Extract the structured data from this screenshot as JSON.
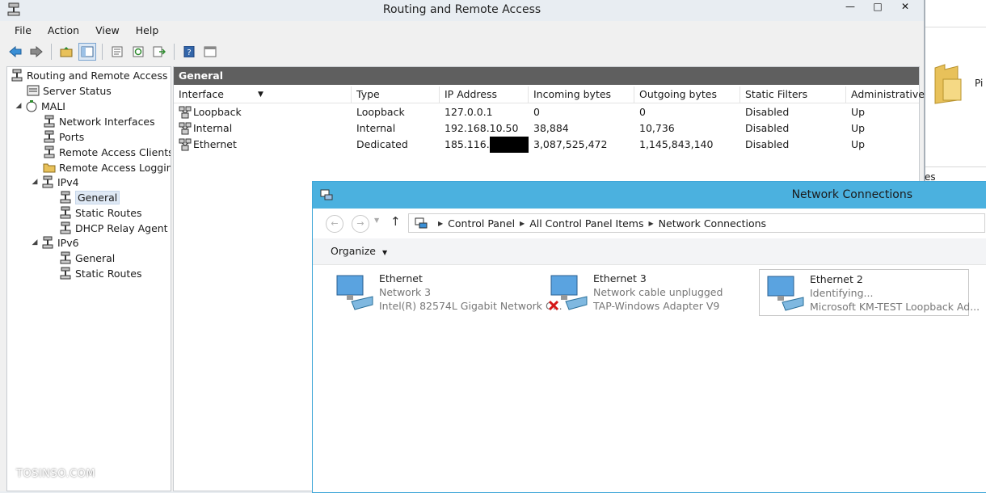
{
  "rras": {
    "title": "Routing and Remote Access",
    "menu": [
      "File",
      "Action",
      "View",
      "Help"
    ],
    "tree": {
      "root": "Routing and Remote Access",
      "server_status": "Server Status",
      "server": "MALI",
      "items": [
        "Network Interfaces",
        "Ports",
        "Remote Access Clients (",
        "Remote Access Logging"
      ],
      "ipv4": "IPv4",
      "ipv4_items": [
        "General",
        "Static Routes",
        "DHCP Relay Agent"
      ],
      "ipv6": "IPv6",
      "ipv6_items": [
        "General",
        "Static Routes"
      ]
    },
    "panel_title": "General",
    "columns": [
      "Interface",
      "Type",
      "IP Address",
      "Incoming bytes",
      "Outgoing bytes",
      "Static Filters",
      "Administrative"
    ],
    "rows": [
      {
        "interface": "Loopback",
        "type": "Loopback",
        "ip": "127.0.0.1",
        "in": "0",
        "out": "0",
        "filters": "Disabled",
        "admin": "Up"
      },
      {
        "interface": "Internal",
        "type": "Internal",
        "ip": "192.168.10.50",
        "in": "38,884",
        "out": "10,736",
        "filters": "Disabled",
        "admin": "Up"
      },
      {
        "interface": "Ethernet",
        "type": "Dedicated",
        "ip": "185.116.",
        "in": "3,087,525,472",
        "out": "1,145,843,140",
        "filters": "Disabled",
        "admin": "Up"
      }
    ]
  },
  "netconn": {
    "title": "Network Connections",
    "breadcrumb": [
      "Control Panel",
      "All Control Panel Items",
      "Network Connections"
    ],
    "organize": "Organize",
    "adapters": [
      {
        "name": "Ethernet",
        "status": "Network  3",
        "device": "Intel(R) 82574L Gigabit Network C..."
      },
      {
        "name": "Ethernet 3",
        "status": "Network cable unplugged",
        "device": "TAP-Windows Adapter V9"
      },
      {
        "name": "Ethernet 2",
        "status": "Identifying...",
        "device": "Microsoft KM-TEST Loopback Ad..."
      }
    ]
  },
  "background": {
    "text1": "Pi",
    "text2": "es"
  },
  "watermark": "TOSINSO.COM"
}
